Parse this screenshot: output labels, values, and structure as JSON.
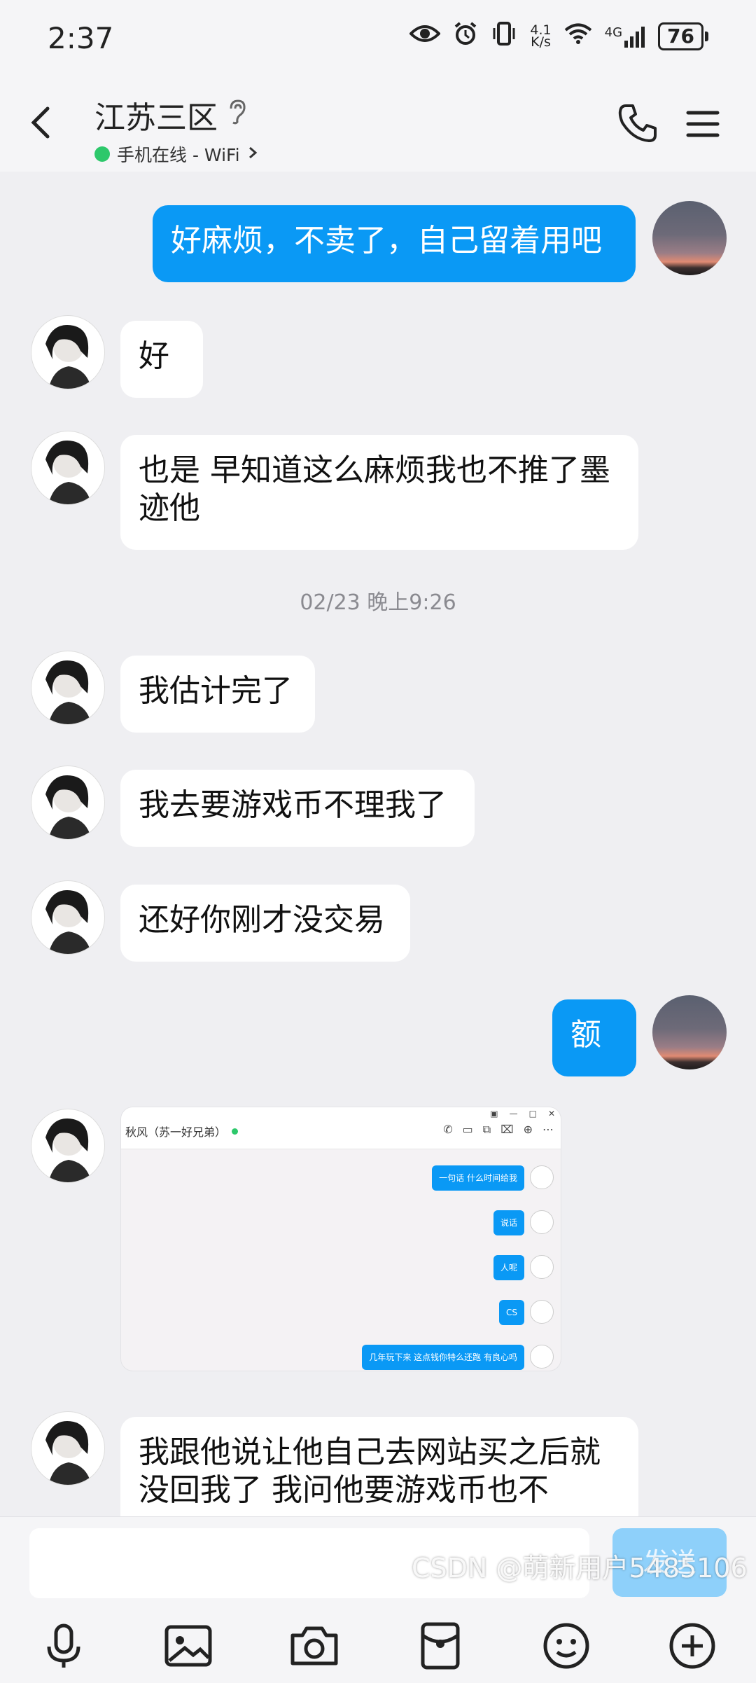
{
  "status_bar": {
    "time": "2:37",
    "net_speed_value": "4.1",
    "net_speed_unit": "K/s",
    "signal_label": "4G",
    "battery": "76"
  },
  "header": {
    "title": "江苏三区",
    "online_status": "手机在线 - WiFi",
    "status_color": "#2dc86b"
  },
  "messages": [
    {
      "side": "out",
      "text": "好麻烦，不卖了，自己留着用吧"
    },
    {
      "side": "in",
      "text": "好"
    },
    {
      "side": "in",
      "text": "也是 早知道这么麻烦我也不推了墨迹他"
    },
    {
      "side": "in",
      "text": "我估计完了"
    },
    {
      "side": "in",
      "text": "我去要游戏币不理我了"
    },
    {
      "side": "in",
      "text": "还好你刚才没交易"
    },
    {
      "side": "out",
      "text": "额"
    },
    {
      "side": "in",
      "text": "我跟他说让他自己去网站买之后就没回我了 我问他要游戏币也不"
    }
  ],
  "timestamp": "02/23 晚上9:26",
  "embedded_screenshot": {
    "contact": "秋风（苏一好兄弟）",
    "messages": [
      "一句话 什么时间给我",
      "说话",
      "人呢",
      "CS",
      "几年玩下来 这点钱你特么还跑 有良心吗"
    ]
  },
  "input": {
    "value": "",
    "send_label": "发送"
  },
  "watermark": "CSDN @萌新用户5485106",
  "colors": {
    "accent": "#0a99f5",
    "send_disabled": "#8ed0fa",
    "background": "#efeff2"
  }
}
